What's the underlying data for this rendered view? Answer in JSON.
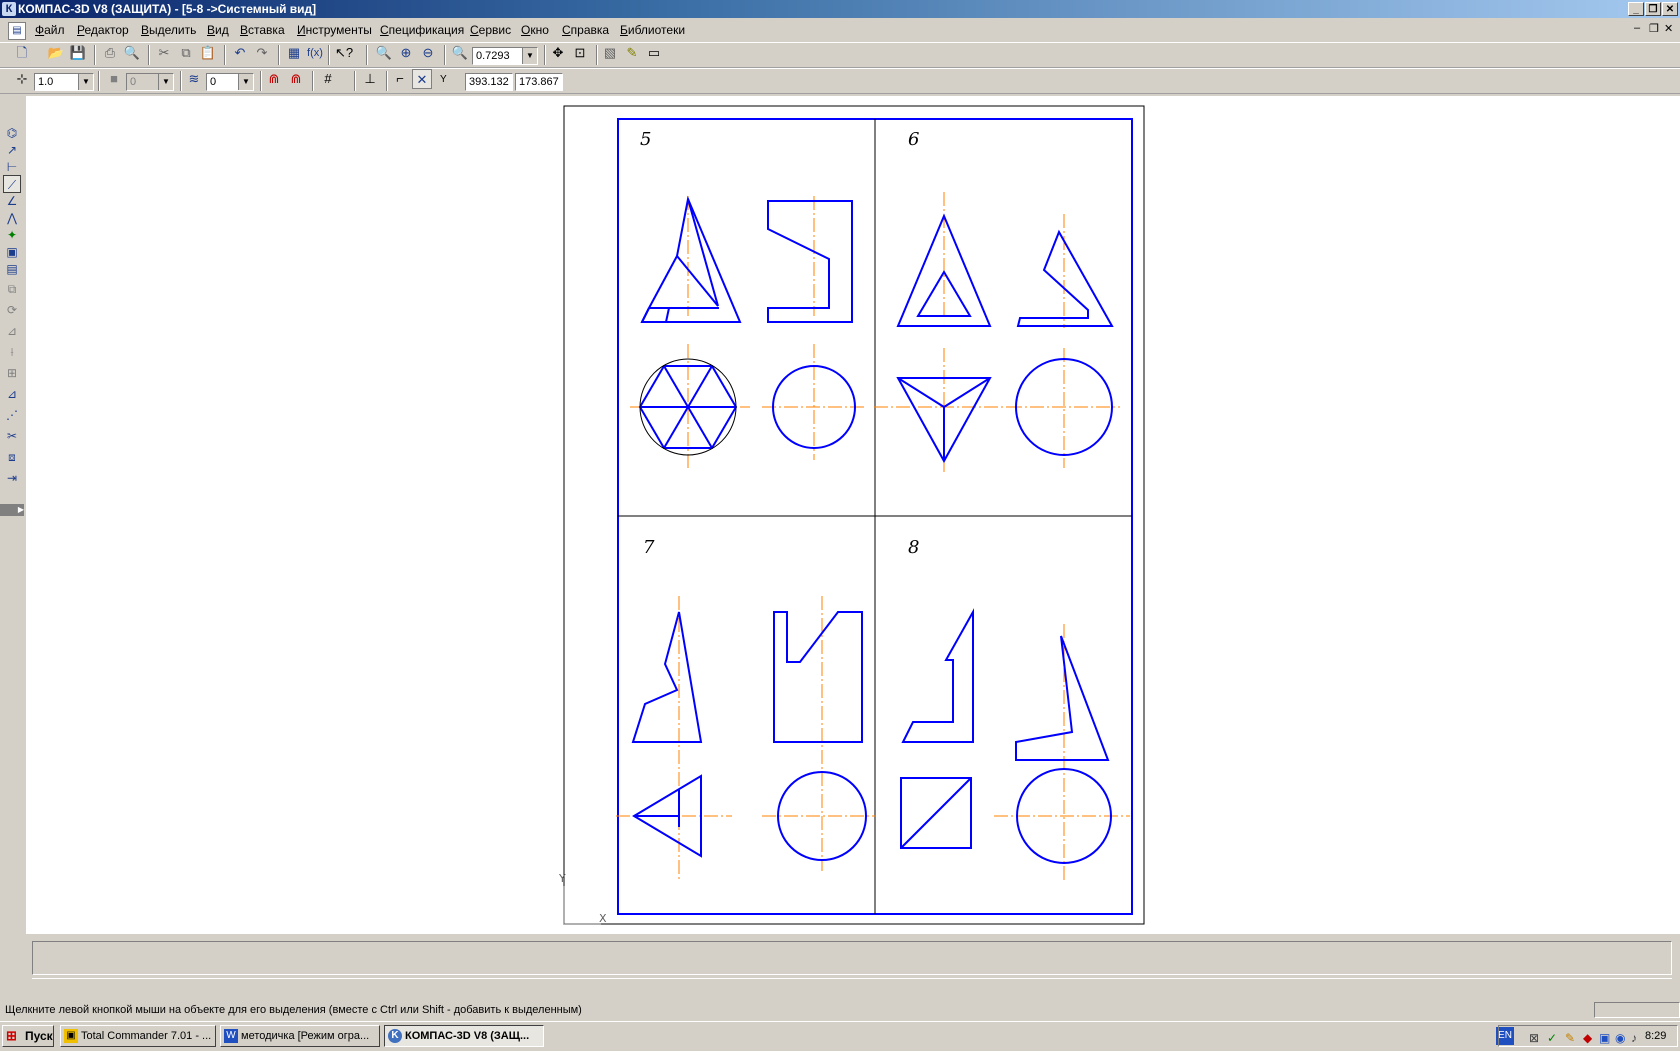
{
  "window": {
    "title": "КОМПАС-3D V8 (ЗАЩИТА) - [5-8 ->Системный вид]",
    "minimize": "_",
    "restore": "❐",
    "close": "✕"
  },
  "menu": {
    "items": [
      "Файл",
      "Редактор",
      "Выделить",
      "Вид",
      "Вставка",
      "Инструменты",
      "Спецификация",
      "Сервис",
      "Окно",
      "Справка",
      "Библиотеки"
    ]
  },
  "toolbar1": {
    "zoom_value": "0.7293"
  },
  "toolbar2": {
    "scale_value": "1.0",
    "layer_value": "0",
    "style_value": "0",
    "coord_label": "Y",
    "coord_x": "393.132",
    "coord_y": "173.867"
  },
  "drawing": {
    "cells": [
      {
        "number": "5"
      },
      {
        "number": "6"
      },
      {
        "number": "7"
      },
      {
        "number": "8"
      }
    ],
    "axis_y_label": "Y",
    "axis_x_label": "X",
    "colors": {
      "contour": "#0000ff",
      "axis": "#ff8000",
      "frame": "#000000",
      "thin": "#000000"
    }
  },
  "statusbar": {
    "hint": "Щелкните левой кнопкой мыши на объекте для его выделения (вместе с Ctrl или Shift - добавить к выделенным)"
  },
  "taskbar": {
    "start_label": "Пуск",
    "tasks": [
      {
        "label": "Total Commander 7.01 - ..."
      },
      {
        "label": "методичка [Режим огра..."
      },
      {
        "label": "КОМПАС-3D V8 (ЗАЩ..."
      }
    ],
    "lang": "EN",
    "clock": "8:29"
  }
}
